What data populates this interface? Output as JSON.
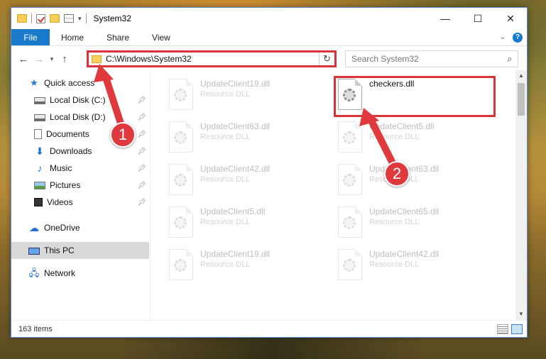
{
  "window": {
    "title": "System32",
    "controls": {
      "minimize": "—",
      "maximize": "☐",
      "close": "✕"
    }
  },
  "ribbon": {
    "tabs": [
      "File",
      "Home",
      "Share",
      "View"
    ]
  },
  "nav": {
    "address": "C:\\Windows\\System32",
    "search_placeholder": "Search System32"
  },
  "sidebar": {
    "items": [
      {
        "label": "Quick access",
        "icon": "star-icon"
      },
      {
        "label": "Local Disk (C:)",
        "icon": "drive-icon"
      },
      {
        "label": "Local Disk (D:)",
        "icon": "drive-icon"
      },
      {
        "label": "Documents",
        "icon": "document-icon"
      },
      {
        "label": "Downloads",
        "icon": "download-icon"
      },
      {
        "label": "Music",
        "icon": "music-icon"
      },
      {
        "label": "Pictures",
        "icon": "pictures-icon"
      },
      {
        "label": "Videos",
        "icon": "video-icon"
      },
      {
        "label": "OneDrive",
        "icon": "cloud-icon"
      },
      {
        "label": "This PC",
        "icon": "computer-icon"
      },
      {
        "label": "Network",
        "icon": "network-icon"
      }
    ]
  },
  "files": {
    "left": [
      {
        "name": "UpdateClient19.dll",
        "type": "Resource DLL"
      },
      {
        "name": "UpdateClient63.dll",
        "type": "Resource DLL"
      },
      {
        "name": "UpdateClient42.dll",
        "type": "Resource DLL"
      },
      {
        "name": "UpdateClient5.dll",
        "type": "Resource DLL"
      },
      {
        "name": "UpdateClient19.dll",
        "type": "Resource DLL"
      }
    ],
    "right": [
      {
        "name": "checkers.dll",
        "type": ""
      },
      {
        "name": "UpdateClient5.dll",
        "type": "Resource DLL"
      },
      {
        "name": "UpdateClient63.dll",
        "type": "Resource DLL"
      },
      {
        "name": "UpdateClient65.dll",
        "type": "Resource DLL"
      },
      {
        "name": "UpdateClient42.dll",
        "type": "Resource DLL"
      }
    ]
  },
  "status": {
    "item_count": "163 items"
  },
  "annotations": {
    "step1": "1",
    "step2": "2",
    "color": "#e0393d"
  }
}
